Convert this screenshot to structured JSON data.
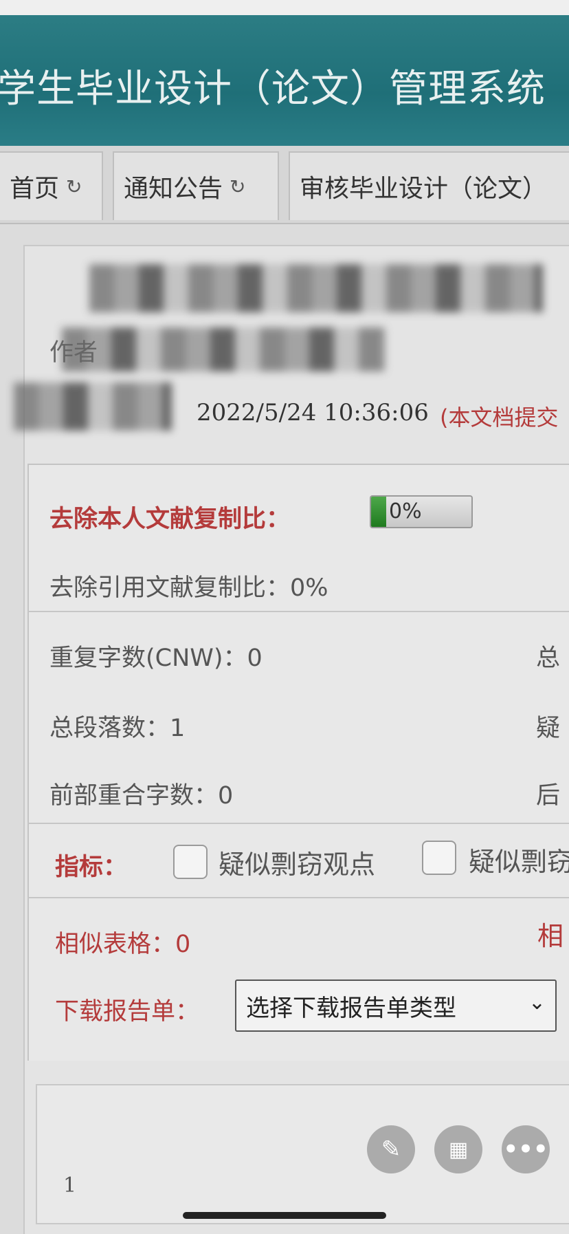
{
  "app": {
    "title": "学生毕业设计（论文）管理系统"
  },
  "tabs": [
    {
      "label": "首页",
      "icon": "refresh-icon"
    },
    {
      "label": "通知公告",
      "icon": "refresh-icon"
    },
    {
      "label": "审核毕业设计（论文）"
    }
  ],
  "doc": {
    "author_label": "作者",
    "submitted_time": "2022/5/24 10:36:06",
    "submitted_note": "(本文档提交"
  },
  "report": {
    "self_copy_label": "去除本人文献复制比：",
    "self_copy_value": "0%",
    "self_copy_ratio": 0.0,
    "cite_copy_label": "去除引用文献复制比：0%",
    "repeat_chars": "重复字数(CNW)：0",
    "repeat_chars_right": "总",
    "paragraphs": "总段落数：1",
    "paragraphs_right": "疑",
    "front_overlap": "前部重合字数：0",
    "front_overlap_right": "后",
    "indicator_label": "指标：",
    "indicator_1": "疑似剽窃观点",
    "indicator_2": "疑似剽窃",
    "similar_tables": "相似表格：0",
    "similar_tables_right": "相",
    "download_label": "下载报告单：",
    "download_select": "选择下载报告单类型"
  },
  "list": {
    "first_index": "1"
  },
  "colors": {
    "header": "#1f6f78",
    "accent_red": "#b43b3b",
    "progress_green": "#2e8b2e"
  }
}
